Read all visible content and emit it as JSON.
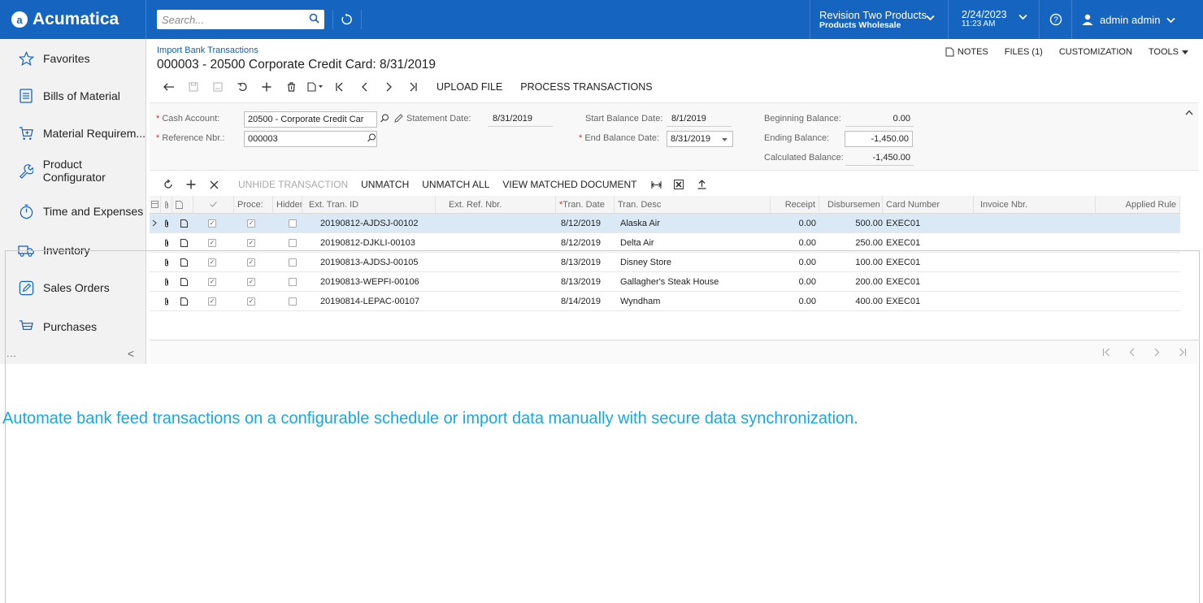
{
  "app": {
    "logo": "Acumatica",
    "search_placeholder": "Search...",
    "company_name": "Revision Two Products",
    "company_branch": "Products Wholesale",
    "date": "2/24/2023",
    "time": "11:23 AM",
    "user": "admin admin",
    "accent_color": "#1565c0"
  },
  "sidebar": {
    "items": [
      {
        "label": "Favorites",
        "icon": "star-icon"
      },
      {
        "label": "Bills of Material",
        "icon": "document-list-icon"
      },
      {
        "label": "Material Requirem...",
        "icon": "cart-plus-icon"
      },
      {
        "label": "Product Configurator",
        "icon": "wrench-icon"
      },
      {
        "label": "Time and Expenses",
        "icon": "stopwatch-icon"
      },
      {
        "label": "Inventory",
        "icon": "truck-icon"
      },
      {
        "label": "Sales Orders",
        "icon": "pencil-icon"
      },
      {
        "label": "Purchases",
        "icon": "cart-icon"
      }
    ],
    "more": "...",
    "collapse": "<"
  },
  "page": {
    "breadcrumb": "Import Bank Transactions",
    "title": "000003 - 20500 Corporate Credit Card: 8/31/2019",
    "notes": "NOTES",
    "files": "FILES (1)",
    "customization": "CUSTOMIZATION",
    "tools": "TOOLS"
  },
  "toolbar": {
    "upload_file": "UPLOAD FILE",
    "process_transactions": "PROCESS TRANSACTIONS"
  },
  "summary": {
    "cash_account_label": "Cash Account:",
    "cash_account_value": "20500 - Corporate Credit Car",
    "reference_nbr_label": "Reference Nbr.:",
    "reference_nbr_value": "000003",
    "statement_date_label": "Statement Date:",
    "statement_date_value": "8/31/2019",
    "start_balance_date_label": "Start Balance Date:",
    "start_balance_date_value": "8/1/2019",
    "end_balance_date_label": "End Balance Date:",
    "end_balance_date_value": "8/31/2019",
    "beginning_balance_label": "Beginning Balance:",
    "beginning_balance_value": "0.00",
    "ending_balance_label": "Ending Balance:",
    "ending_balance_value": "-1,450.00",
    "calculated_balance_label": "Calculated Balance:",
    "calculated_balance_value": "-1,450.00"
  },
  "grid_toolbar": {
    "unhide_transaction": "UNHIDE TRANSACTION",
    "unmatch": "UNMATCH",
    "unmatch_all": "UNMATCH ALL",
    "view_matched_document": "VIEW MATCHED DOCUMENT"
  },
  "grid": {
    "columns": {
      "processed": "Proce:",
      "hidden": "Hidder",
      "ext_tran_id": "Ext. Tran. ID",
      "ext_ref_nbr": "Ext. Ref. Nbr.",
      "tran_date": "Tran. Date",
      "tran_desc": "Tran. Desc",
      "receipt": "Receipt",
      "disbursement": "Disbursemen",
      "card_number": "Card Number",
      "invoice_nbr": "Invoice Nbr.",
      "applied_rule": "Applied Rule"
    },
    "rows": [
      {
        "ext_tran_id": "20190812-AJDSJ-00102",
        "tran_date": "8/12/2019",
        "tran_desc": "Alaska Air",
        "receipt": "0.00",
        "disbursement": "500.00",
        "card_number": "EXEC01"
      },
      {
        "ext_tran_id": "20190812-DJKLI-00103",
        "tran_date": "8/12/2019",
        "tran_desc": "Delta Air",
        "receipt": "0.00",
        "disbursement": "250.00",
        "card_number": "EXEC01"
      },
      {
        "ext_tran_id": "20190813-AJDSJ-00105",
        "tran_date": "8/13/2019",
        "tran_desc": "Disney Store",
        "receipt": "0.00",
        "disbursement": "100.00",
        "card_number": "EXEC01"
      },
      {
        "ext_tran_id": "20190813-WEPFI-00106",
        "tran_date": "8/13/2019",
        "tran_desc": "Gallagher's Steak House",
        "receipt": "0.00",
        "disbursement": "200.00",
        "card_number": "EXEC01"
      },
      {
        "ext_tran_id": "20190814-LEPAC-00107",
        "tran_date": "8/14/2019",
        "tran_desc": "Wyndham",
        "receipt": "0.00",
        "disbursement": "400.00",
        "card_number": "EXEC01"
      }
    ]
  },
  "caption": "Automate bank feed transactions on a configurable schedule or import data manually with secure data synchronization."
}
